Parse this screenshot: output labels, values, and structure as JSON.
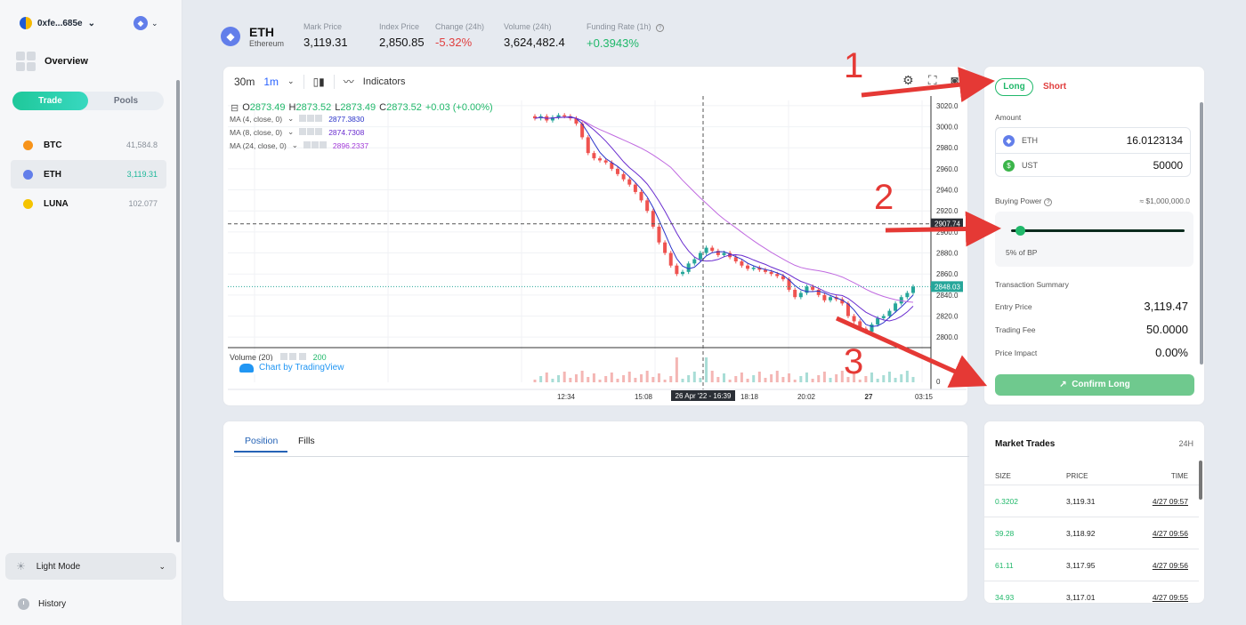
{
  "wallet": {
    "address": "0xfe...685e",
    "network_icon": "ethereum-icon"
  },
  "nav": {
    "overview": "Overview",
    "trade_tab": "Trade",
    "pools_tab": "Pools"
  },
  "assets": [
    {
      "symbol": "BTC",
      "price": "41,584.8",
      "color": "#f7931a"
    },
    {
      "symbol": "ETH",
      "price": "3,119.31",
      "color": "#627eea"
    },
    {
      "symbol": "LUNA",
      "price": "102.077",
      "color": "#f5c400"
    }
  ],
  "sidebar_bottom": {
    "theme": "Light Mode",
    "history": "History"
  },
  "header": {
    "symbol": "ETH",
    "name": "Ethereum",
    "stats": [
      {
        "label": "Mark Price",
        "value": "3,119.31"
      },
      {
        "label": "Index Price",
        "value": "2,850.85"
      },
      {
        "label": "Change (24h)",
        "value": "-5.32%"
      },
      {
        "label": "Volume (24h)",
        "value": "3,624,482.4"
      },
      {
        "label": "Funding Rate (1h)",
        "value": "+0.3943%"
      }
    ]
  },
  "chart_toolbar": {
    "tf_30m": "30m",
    "tf_1m": "1m",
    "indicators": "Indicators"
  },
  "chart_legend": {
    "o": "2873.49",
    "h": "2873.52",
    "l": "2873.49",
    "c": "2873.52",
    "chg": "+0.03 (+0.00%)",
    "ma": [
      {
        "label": "MA (4, close, 0)",
        "value": "2877.3830",
        "color": "#2a33c9"
      },
      {
        "label": "MA (8, close, 0)",
        "value": "2874.7308",
        "color": "#6a2ccf"
      },
      {
        "label": "MA (24, close, 0)",
        "value": "2896.2337",
        "color": "#a23ad8"
      }
    ],
    "volume_label": "Volume (20)",
    "volume_value": "200",
    "tradingview": "Chart by TradingView"
  },
  "chart_data": {
    "type": "candlestick",
    "y_ticks": [
      3020,
      3000,
      2980,
      2960,
      2940,
      2920,
      2900,
      2880,
      2860,
      2840,
      2820,
      2800
    ],
    "ylim": [
      2790,
      3025
    ],
    "x_ticks": [
      "12:34",
      "15:08",
      "18:18",
      "20:02",
      "27",
      "03:15"
    ],
    "crosshair_time": "26 Apr '22 - 16:39",
    "crosshair_price": "2907.74",
    "last_price": "2848.03",
    "volume_axis_label": "0",
    "closes": [
      3008,
      3010,
      3006,
      3009,
      3011,
      3010,
      3008,
      3003,
      2990,
      2975,
      2970,
      2968,
      2966,
      2960,
      2955,
      2950,
      2945,
      2938,
      2930,
      2920,
      2905,
      2890,
      2880,
      2868,
      2860,
      2862,
      2870,
      2874,
      2880,
      2885,
      2882,
      2878,
      2880,
      2876,
      2872,
      2868,
      2865,
      2866,
      2864,
      2862,
      2860,
      2858,
      2855,
      2845,
      2838,
      2842,
      2848,
      2845,
      2840,
      2835,
      2838,
      2836,
      2832,
      2820,
      2815,
      2808,
      2805,
      2812,
      2818,
      2820,
      2825,
      2832,
      2838,
      2842,
      2848
    ]
  },
  "order": {
    "long": "Long",
    "short": "Short",
    "amount_label": "Amount",
    "eth_label": "ETH",
    "eth_value": "16.0123134",
    "ust_label": "UST",
    "ust_value": "50000",
    "buying_power_label": "Buying Power",
    "buying_power_value": "≈ $1,000,000.0",
    "slider_pct": 0.05,
    "slider_text": "5% of BP",
    "summary_label": "Transaction Summary",
    "entry_label": "Entry Price",
    "entry_value": "3,119.47",
    "fee_label": "Trading Fee",
    "fee_value": "50.0000",
    "impact_label": "Price Impact",
    "impact_value": "0.00%",
    "confirm": "Confirm Long"
  },
  "positions": {
    "tab_position": "Position",
    "tab_fills": "Fills"
  },
  "market_trades": {
    "title": "Market Trades",
    "period": "24H",
    "headers": [
      "SIZE",
      "PRICE",
      "TIME"
    ],
    "rows": [
      [
        "0.3202",
        "3,119.31",
        "4/27 09:57"
      ],
      [
        "39.28",
        "3,118.92",
        "4/27 09:56"
      ],
      [
        "61.11",
        "3,117.95",
        "4/27 09:56"
      ],
      [
        "34.93",
        "3,117.01",
        "4/27 09:55"
      ]
    ]
  },
  "annotations": [
    "1",
    "2",
    "3"
  ]
}
